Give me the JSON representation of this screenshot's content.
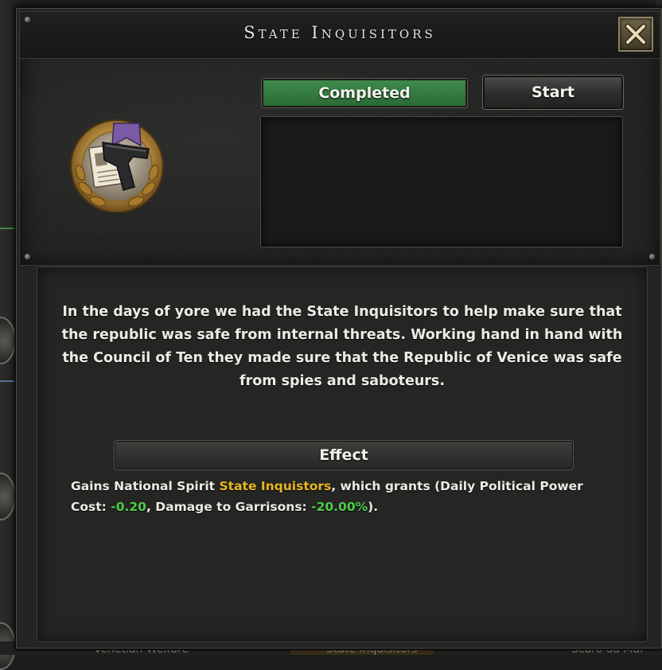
{
  "window": {
    "title": "State Inquisitors",
    "close_icon": "close-x-icon"
  },
  "focus": {
    "emblem_icon": "pistol-dossier-emblem-icon",
    "status": "Completed",
    "start_label": "Start",
    "description": "In the days of yore we had the State Inquisitors to help make sure that the republic was safe from internal threats. Working hand in hand with the Council of Ten they made sure that the Republic of Venice was safe from spies and saboteurs."
  },
  "effect": {
    "header": "Effect",
    "prefix": "Gains National Spirit ",
    "spirit_name": "State Inquistors",
    "mid1": ", which grants (Daily Political Power Cost: ",
    "pp_cost": "-0.20",
    "mid2": ", Damage to Garrisons: ",
    "garrison_damage": "-20.00%",
    "suffix": ")."
  },
  "background": {
    "labels": [
      "Venetian Welfare",
      "State Inquisitors",
      "Scaro da Mar"
    ]
  },
  "colors": {
    "status_green": "#2f7a3d",
    "highlight_yellow": "#e6b81e",
    "positive_green": "#4fcd4a"
  }
}
